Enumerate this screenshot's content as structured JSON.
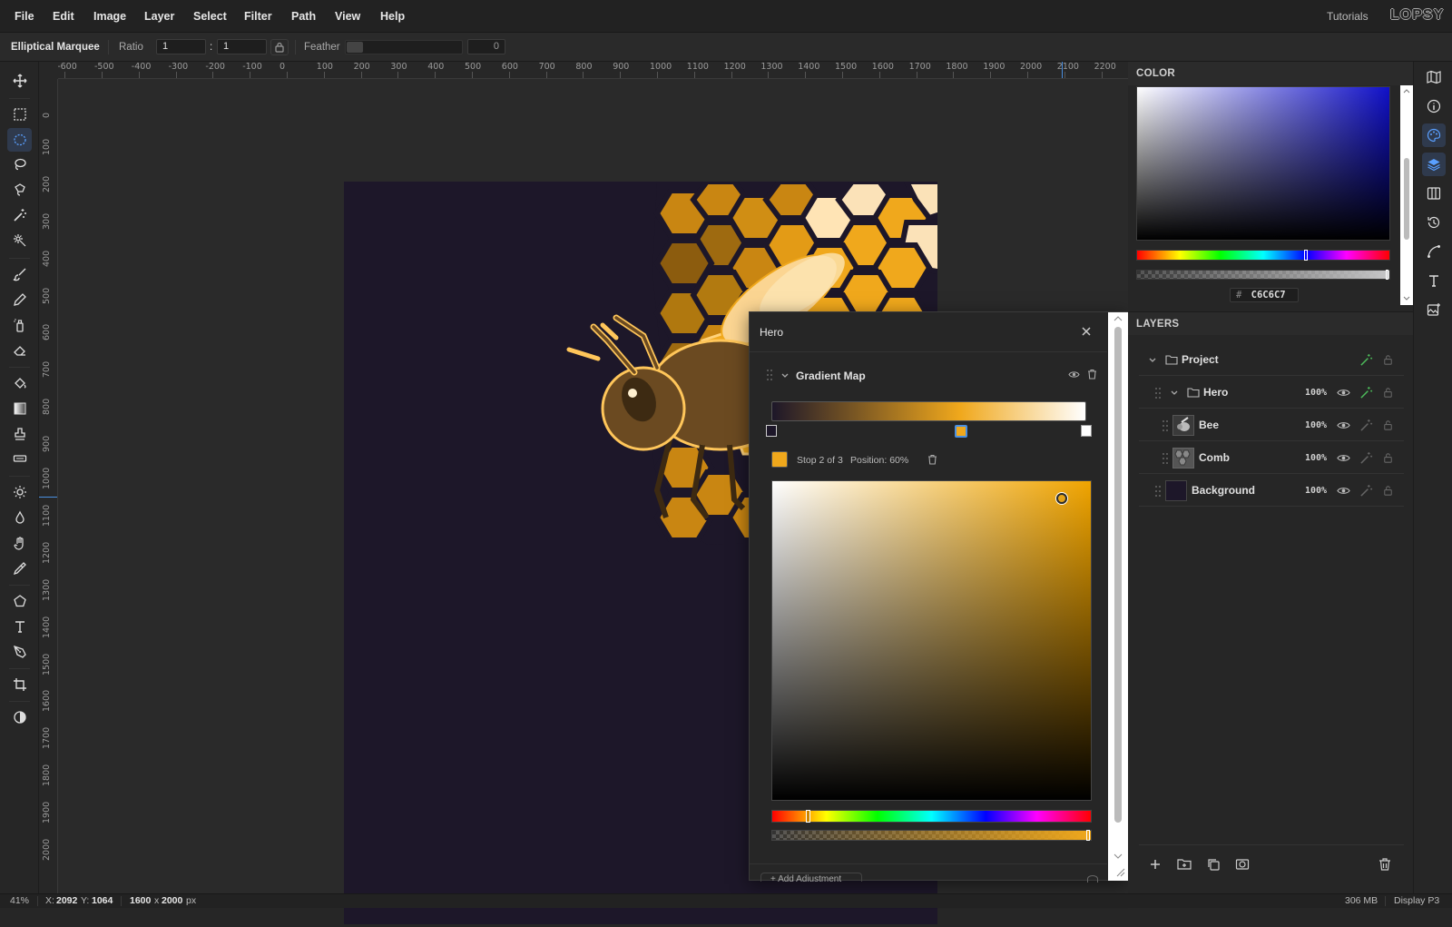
{
  "menu": {
    "items": [
      "File",
      "Edit",
      "Image",
      "Layer",
      "Select",
      "Filter",
      "Path",
      "View",
      "Help"
    ],
    "tutorials": "Tutorials",
    "logo": "LOPSY"
  },
  "options": {
    "tool_name": "Elliptical Marquee",
    "ratio_label": "Ratio",
    "ratio_w": "1",
    "ratio_sep": ":",
    "ratio_h": "1",
    "feather_label": "Feather",
    "feather_value": "0"
  },
  "ruler": {
    "h_labels": [
      "-600",
      "-500",
      "-400",
      "-300",
      "-200",
      "-100",
      "0",
      "100",
      "200",
      "300",
      "400",
      "500",
      "600",
      "700",
      "800",
      "900",
      "1000",
      "1100",
      "1200",
      "1300",
      "1400",
      "1500",
      "1600",
      "1700",
      "1800",
      "1900",
      "2000",
      "2100",
      "2200"
    ],
    "v_labels": [
      "0",
      "100",
      "200",
      "300",
      "400",
      "500",
      "600",
      "700",
      "800",
      "900",
      "1000",
      "1100",
      "1200",
      "1300",
      "1400",
      "1500",
      "1600",
      "1700",
      "1800",
      "1900",
      "2000"
    ]
  },
  "tools": [
    "move-tool",
    "rect-marquee-tool",
    "ellipse-marquee-tool",
    "lasso-tool",
    "polygon-lasso-tool",
    "magic-wand-tool",
    "quick-select-tool",
    "brush-tool",
    "pencil-tool",
    "spray-tool",
    "eraser-tool",
    "fill-tool",
    "gradient-tool",
    "clone-stamp-tool",
    "healing-tool",
    "dodge-tool",
    "blur-tool",
    "hand-tool",
    "eyedropper-tool",
    "shape-tool",
    "text-tool",
    "pen-tool",
    "crop-tool",
    "adjust-tool"
  ],
  "color_panel": {
    "title": "COLOR",
    "hex_prefix": "#",
    "hex_value": "C6C6C7",
    "hue_marker_pct": 67
  },
  "layers_panel": {
    "title": "LAYERS",
    "project": {
      "name": "Project"
    },
    "rows": [
      {
        "name": "Hero",
        "opacity": "100%"
      },
      {
        "name": "Bee",
        "opacity": "100%"
      },
      {
        "name": "Comb",
        "opacity": "100%"
      },
      {
        "name": "Background",
        "opacity": "100%"
      }
    ]
  },
  "dialog": {
    "title": "Hero",
    "adjustment_name": "Gradient Map",
    "stop_info": "Stop 2 of 3",
    "position_info": "Position: 60%",
    "stop_color": "#F0A81C",
    "gradient_stops": [
      {
        "position": 0,
        "color": "#1D1729"
      },
      {
        "position": 60,
        "color": "#F0A81C"
      },
      {
        "position": 100,
        "color": "#FFFFFF"
      }
    ],
    "hue_marker_pct": 11,
    "add_label": "+ Add Adjustment"
  },
  "status": {
    "zoom": "41%",
    "x_label": "X:",
    "x_value": "2092",
    "y_label": "Y:",
    "y_value": "1064",
    "width": "1600",
    "times": "x",
    "height": "2000",
    "unit": "px",
    "memory": "306 MB",
    "color_profile": "Display P3"
  },
  "colors": {
    "accent": "#4A8FE0",
    "honey": "#F0A81C",
    "canvas_bg": "#1D1729",
    "green": "#4CBB5A"
  }
}
